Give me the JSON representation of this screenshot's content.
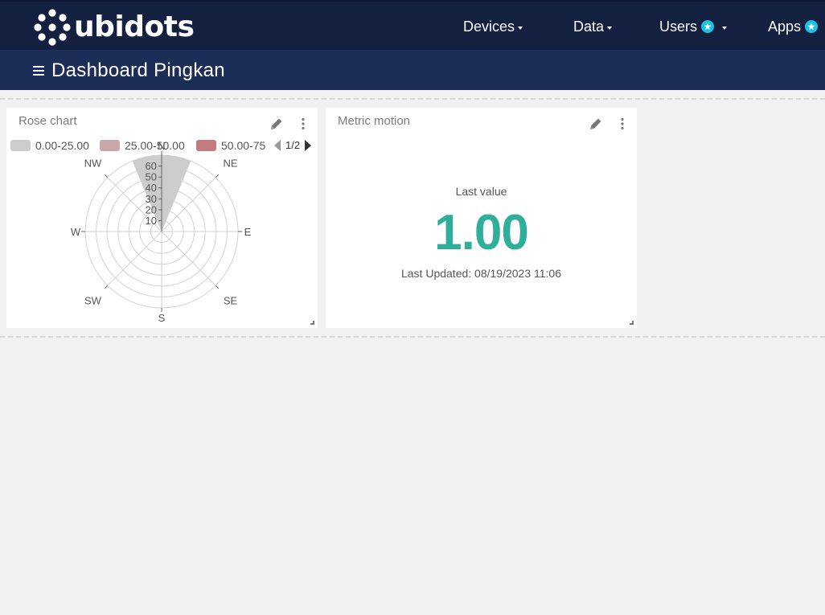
{
  "brand": {
    "name": "ubidots",
    "accent": "#1ec0e4"
  },
  "nav": [
    {
      "label": "Devices",
      "has_caret": true,
      "badge": false
    },
    {
      "label": "Data",
      "has_caret": true,
      "badge": false
    },
    {
      "label": "Users",
      "has_caret": true,
      "badge": true
    },
    {
      "label": "Apps",
      "has_caret": false,
      "badge": true
    }
  ],
  "dashboard": {
    "title": "Dashboard Pingkan",
    "menu_icon": "hamburger-icon"
  },
  "widgets": {
    "rose": {
      "title": "Rose chart",
      "legend": [
        {
          "label": "0.00-25.00",
          "color": "#cccccc"
        },
        {
          "label": "25.00-50.00",
          "color": "#c9a7a7"
        },
        {
          "label": "50.00-75",
          "color": "#c47b7f"
        }
      ],
      "pager": "1/2"
    },
    "metric": {
      "title": "Metric motion",
      "last_value_label": "Last value",
      "value": "1.00",
      "updated": "Last Updated: 08/19/2023 11:06",
      "value_color": "#2fae9c"
    }
  },
  "chart_data": {
    "type": "rose",
    "directions": [
      "N",
      "NE",
      "E",
      "SE",
      "S",
      "SW",
      "W",
      "NW"
    ],
    "radial_ticks": [
      10,
      20,
      30,
      40,
      50,
      60
    ],
    "rmax": 70,
    "series": [
      {
        "name": "0.00-25.00",
        "color": "#cccccc",
        "values": [
          70,
          0,
          0,
          0,
          0,
          0,
          0,
          0
        ]
      }
    ]
  }
}
